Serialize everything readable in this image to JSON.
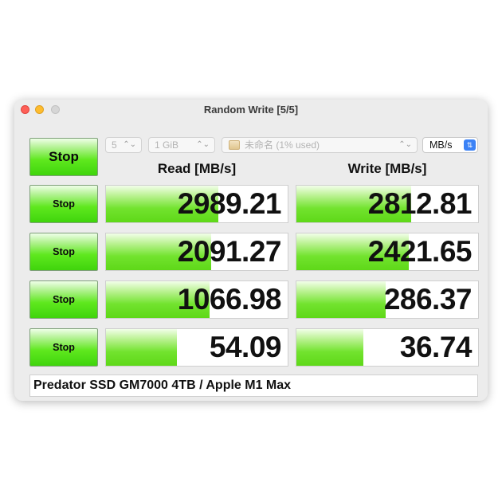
{
  "window": {
    "title": "Random Write [5/5]"
  },
  "controls": {
    "all_button_label": "Stop",
    "loops": "5",
    "test_size": "1 GiB",
    "drive": "未命名 (1% used)",
    "unit": "MB/s"
  },
  "headers": {
    "read": "Read [MB/s]",
    "write": "Write [MB/s]"
  },
  "rows": [
    {
      "button_label": "Stop",
      "read": "2989.21",
      "write": "2812.81",
      "read_fill": 0.62,
      "write_fill": 0.63
    },
    {
      "button_label": "Stop",
      "read": "2091.27",
      "write": "2421.65",
      "read_fill": 0.58,
      "write_fill": 0.62
    },
    {
      "button_label": "Stop",
      "read": "1066.98",
      "write": "286.37",
      "read_fill": 0.57,
      "write_fill": 0.49
    },
    {
      "button_label": "Stop",
      "read": "54.09",
      "write": "36.74",
      "read_fill": 0.39,
      "write_fill": 0.37
    }
  ],
  "comment": "Predator SSD GM7000 4TB / Apple M1 Max",
  "colors": {
    "bar_green": "#5ed818",
    "unit_accent": "#3b82f6"
  }
}
